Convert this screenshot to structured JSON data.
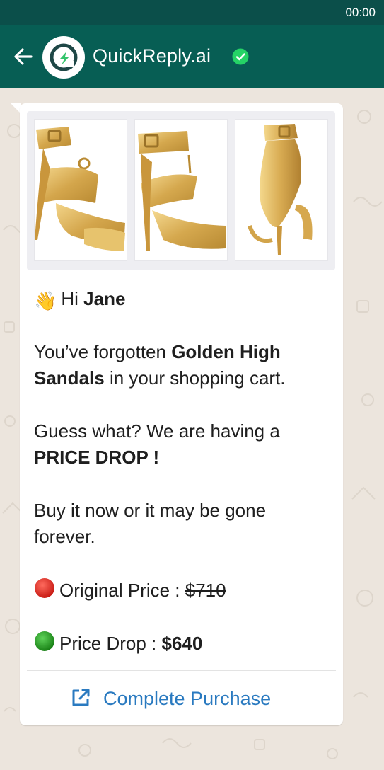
{
  "status_bar": {
    "time": "00:00"
  },
  "header": {
    "back_icon": "arrow-back-icon",
    "app_name": "QuickReply.ai",
    "verified_icon": "verified-check-icon",
    "avatar_icon": "quickreply-logo",
    "colors": {
      "bar": "#075e54",
      "status": "#0b4f4a",
      "verified": "#25d366"
    }
  },
  "message": {
    "images": [
      {
        "name": "sandal-angle-view"
      },
      {
        "name": "sandal-side-view"
      },
      {
        "name": "sandal-back-view"
      }
    ],
    "greeting": {
      "emoji": "👋",
      "text": "Hi ",
      "name": "Jane"
    },
    "forgot": {
      "prefix": "You’ve forgotten ",
      "product_line1": "Golden High",
      "product_line2": "Sandals",
      "suffix": " in your shopping cart."
    },
    "promo": {
      "line1": "Guess what? We are having a",
      "highlight": "PRICE DROP !"
    },
    "urgency": {
      "line1": "Buy it now or it may be gone",
      "line2": "forever."
    },
    "original_price": {
      "icon": "red-circle-icon",
      "label": "Original Price : ",
      "value": "$710"
    },
    "price_drop": {
      "icon": "green-circle-icon",
      "label": "Price Drop : ",
      "value": "$640"
    },
    "cta": {
      "icon": "external-link-icon",
      "label": "Complete Purchase",
      "color": "#2a7ac0"
    }
  }
}
